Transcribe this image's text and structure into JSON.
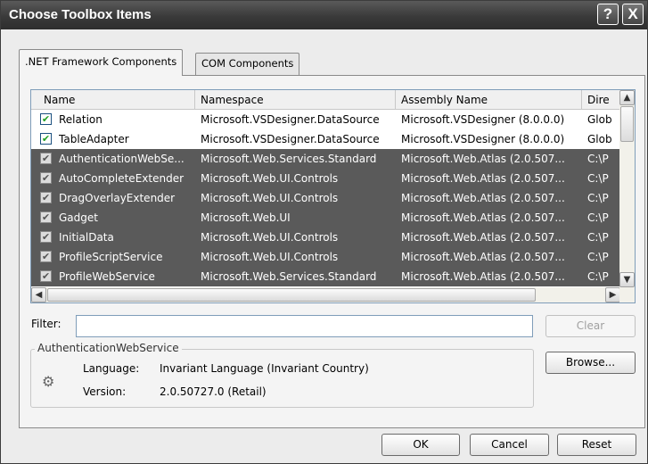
{
  "window": {
    "title": "Choose Toolbox Items",
    "help_glyph": "?",
    "close_glyph": "X"
  },
  "tabs": [
    {
      "label": ".NET Framework Components",
      "active": true
    },
    {
      "label": "COM Components",
      "active": false
    }
  ],
  "columns": [
    "Name",
    "Namespace",
    "Assembly Name",
    "Dire"
  ],
  "rows": [
    {
      "checked": true,
      "selected": false,
      "name": "Relation",
      "namespace": "Microsoft.VSDesigner.DataSource",
      "assembly": "Microsoft.VSDesigner (8.0.0.0)",
      "dir": "Glob"
    },
    {
      "checked": true,
      "selected": false,
      "name": "TableAdapter",
      "namespace": "Microsoft.VSDesigner.DataSource",
      "assembly": "Microsoft.VSDesigner (8.0.0.0)",
      "dir": "Glob"
    },
    {
      "checked": true,
      "selected": true,
      "name": "AuthenticationWebSe...",
      "namespace": "Microsoft.Web.Services.Standard",
      "assembly": "Microsoft.Web.Atlas (2.0.507...",
      "dir": "C:\\P"
    },
    {
      "checked": true,
      "selected": true,
      "name": "AutoCompleteExtender",
      "namespace": "Microsoft.Web.UI.Controls",
      "assembly": "Microsoft.Web.Atlas (2.0.507...",
      "dir": "C:\\P"
    },
    {
      "checked": true,
      "selected": true,
      "name": "DragOverlayExtender",
      "namespace": "Microsoft.Web.UI.Controls",
      "assembly": "Microsoft.Web.Atlas (2.0.507...",
      "dir": "C:\\P"
    },
    {
      "checked": true,
      "selected": true,
      "name": "Gadget",
      "namespace": "Microsoft.Web.UI",
      "assembly": "Microsoft.Web.Atlas (2.0.507...",
      "dir": "C:\\P"
    },
    {
      "checked": true,
      "selected": true,
      "name": "InitialData",
      "namespace": "Microsoft.Web.UI.Controls",
      "assembly": "Microsoft.Web.Atlas (2.0.507...",
      "dir": "C:\\P"
    },
    {
      "checked": true,
      "selected": true,
      "name": "ProfileScriptService",
      "namespace": "Microsoft.Web.UI.Controls",
      "assembly": "Microsoft.Web.Atlas (2.0.507...",
      "dir": "C:\\P"
    },
    {
      "checked": true,
      "selected": true,
      "name": "ProfileWebService",
      "namespace": "Microsoft.Web.Services.Standard",
      "assembly": "Microsoft.Web.Atlas (2.0.507...",
      "dir": "C:\\P"
    }
  ],
  "filter": {
    "label": "Filter:",
    "value": "",
    "clear_label": "Clear"
  },
  "details": {
    "group_title": "AuthenticationWebService",
    "language_label": "Language:",
    "language_value": "Invariant Language (Invariant Country)",
    "version_label": "Version:",
    "version_value": "2.0.50727.0 (Retail)",
    "icon": "gear-icon"
  },
  "buttons": {
    "browse": "Browse...",
    "ok": "OK",
    "cancel": "Cancel",
    "reset": "Reset"
  },
  "colors": {
    "title_bar": "#3a3a3a",
    "selection": "#5a5a5a"
  }
}
